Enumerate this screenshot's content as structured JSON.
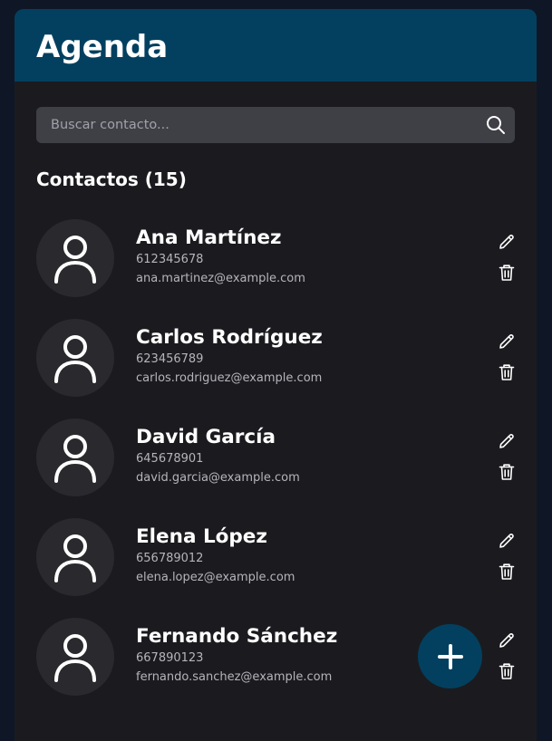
{
  "header": {
    "title": "Agenda"
  },
  "search": {
    "placeholder": "Buscar contacto...",
    "icon": "search-icon"
  },
  "list": {
    "title": "Contactos (15)"
  },
  "contacts": [
    {
      "name": "Ana Martínez",
      "phone": "612345678",
      "email": "ana.martinez@example.com"
    },
    {
      "name": "Carlos Rodríguez",
      "phone": "623456789",
      "email": "carlos.rodriguez@example.com"
    },
    {
      "name": "David García",
      "phone": "645678901",
      "email": "david.garcia@example.com"
    },
    {
      "name": "Elena López",
      "phone": "656789012",
      "email": "elena.lopez@example.com"
    },
    {
      "name": "Fernando Sánchez",
      "phone": "667890123",
      "email": "fernando.sanchez@example.com"
    }
  ],
  "colors": {
    "accent": "#03405f",
    "background": "#1b1b1f",
    "page_background": "#0f1726",
    "input_background": "#3f3f46",
    "avatar_background": "#2a2a2e"
  },
  "icons": {
    "avatar": "user-icon",
    "edit": "pencil-icon",
    "delete": "trash-icon",
    "add": "plus-icon"
  }
}
